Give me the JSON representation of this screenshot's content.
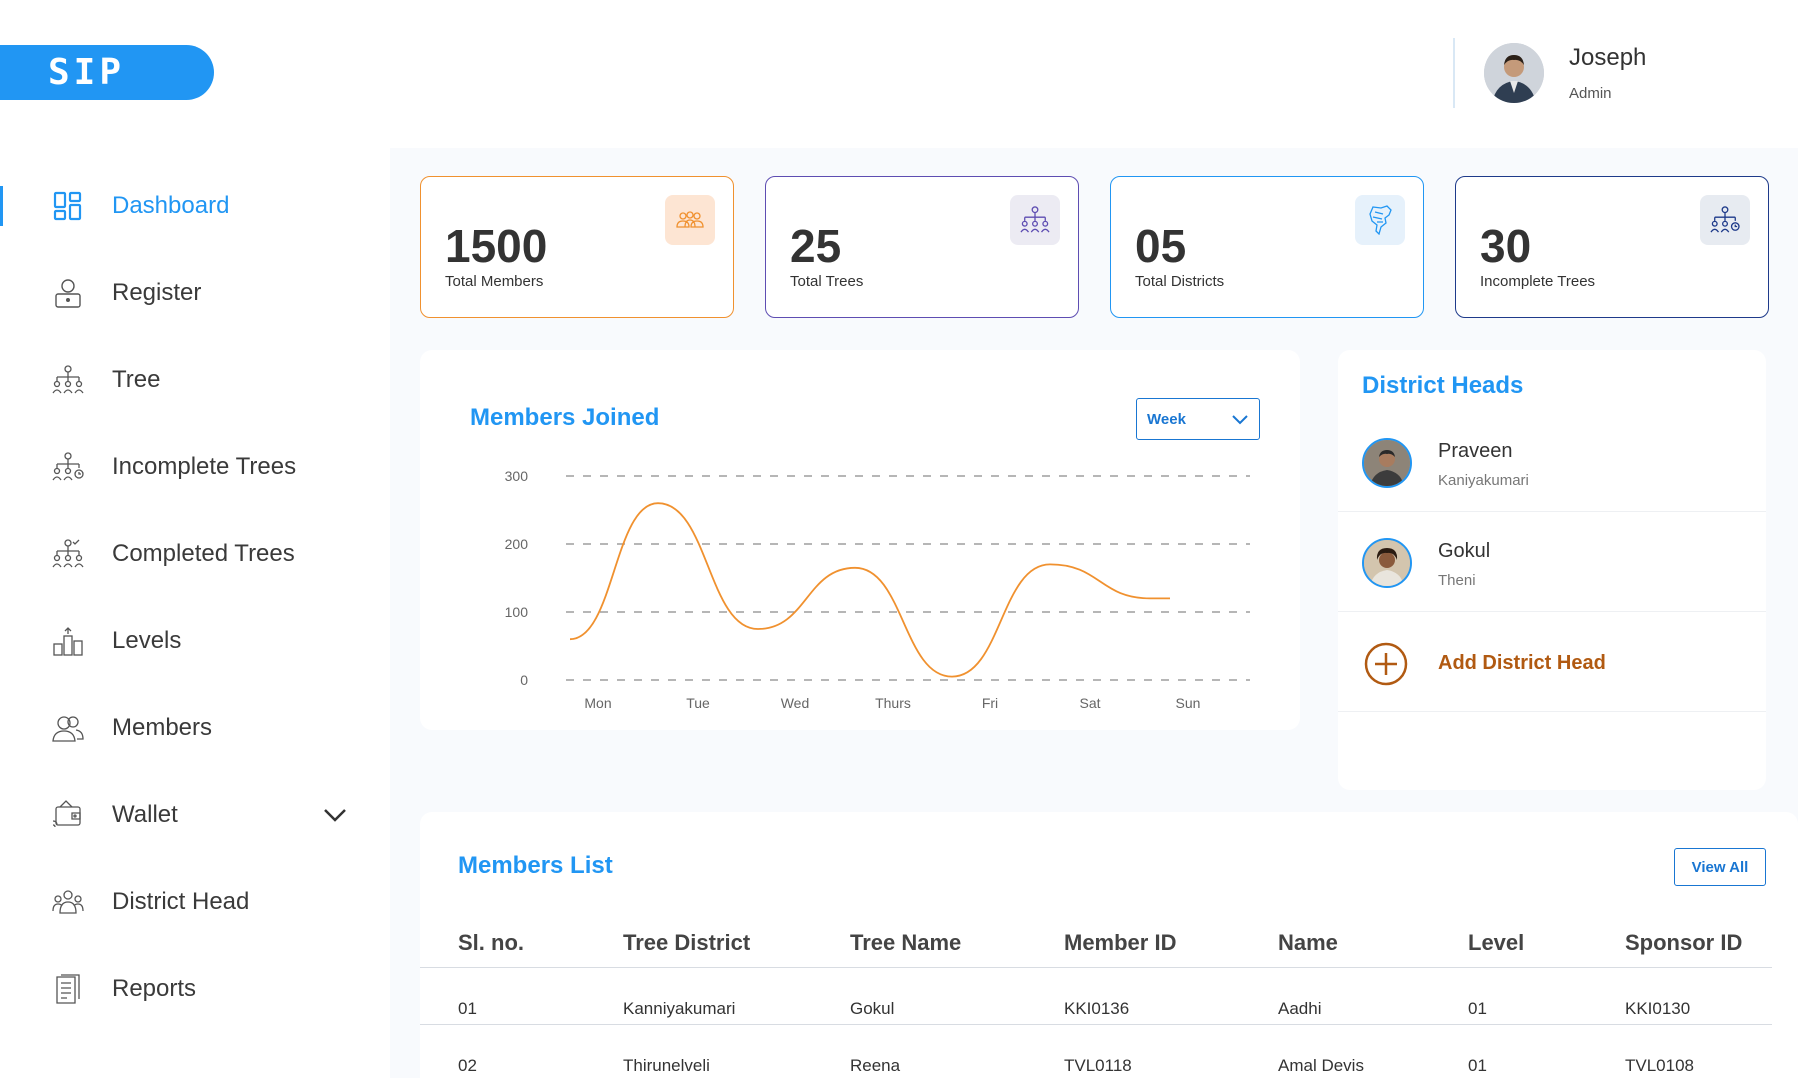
{
  "header": {
    "logo": "SIP",
    "user_name": "Joseph",
    "user_role": "Admin"
  },
  "sidebar": {
    "items": [
      {
        "label": "Dashboard",
        "icon": "dashboard-icon",
        "active": true
      },
      {
        "label": "Register",
        "icon": "register-icon"
      },
      {
        "label": "Tree",
        "icon": "tree-icon"
      },
      {
        "label": "Incomplete Trees",
        "icon": "incomplete-tree-icon"
      },
      {
        "label": "Completed Trees",
        "icon": "completed-tree-icon"
      },
      {
        "label": "Levels",
        "icon": "levels-icon"
      },
      {
        "label": "Members",
        "icon": "members-icon"
      },
      {
        "label": "Wallet",
        "icon": "wallet-icon",
        "expandable": true
      },
      {
        "label": "District Head",
        "icon": "district-head-icon"
      },
      {
        "label": "Reports",
        "icon": "reports-icon"
      }
    ]
  },
  "stats": [
    {
      "value": "1500",
      "label": "Total Members",
      "color": "#f0912f",
      "icon_bg": "#fde5d3",
      "icon": "group-icon"
    },
    {
      "value": "25",
      "label": "Total Trees",
      "color": "#5e4db2",
      "icon_bg": "#ecebf3",
      "icon": "tree-icon"
    },
    {
      "value": "05",
      "label": "Total Districts",
      "color": "#2196f3",
      "icon_bg": "#e6f1fb",
      "icon": "map-icon"
    },
    {
      "value": "30",
      "label": "Incomplete Trees",
      "color": "#1e3a8a",
      "icon_bg": "#e7ebf1",
      "icon": "incomplete-tree-icon"
    }
  ],
  "members_joined": {
    "title": "Members Joined",
    "period": "Week"
  },
  "chart_data": {
    "type": "line",
    "title": "Members Joined",
    "categories": [
      "Mon",
      "Tue",
      "Wed",
      "Thurs",
      "Fri",
      "Sat",
      "Sun"
    ],
    "yticks": [
      "300",
      "200",
      "100",
      "0"
    ],
    "ylim": [
      0,
      300
    ],
    "series": [
      {
        "values": [
          60,
          260,
          75,
          165,
          5,
          170,
          120
        ],
        "color": "#f0912f"
      }
    ],
    "grid": true
  },
  "district_heads": {
    "title": "District Heads",
    "items": [
      {
        "name": "Praveen",
        "district": "Kaniyakumari"
      },
      {
        "name": "Gokul",
        "district": "Theni"
      }
    ],
    "add_label": "Add District Head"
  },
  "members_list": {
    "title": "Members List",
    "view_all": "View All",
    "columns": [
      "Sl. no.",
      "Tree District",
      "Tree Name",
      "Member ID",
      "Name",
      "Level",
      "Sponsor ID"
    ],
    "rows": [
      [
        "01",
        "Kanniyakumari",
        "Gokul",
        "KKI0136",
        "Aadhi",
        "01",
        "KKI0130"
      ],
      [
        "02",
        "Thirunelveli",
        "Reena",
        "TVL0118",
        "Amal Devis",
        "01",
        "TVL0108"
      ]
    ]
  }
}
